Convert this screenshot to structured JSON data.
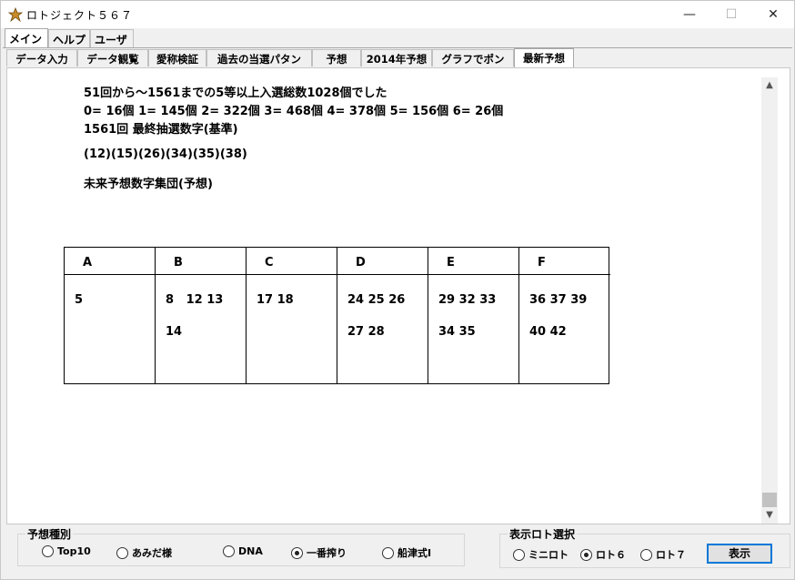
{
  "window": {
    "title": "ロトジェクト５６７",
    "controls": {
      "minimize": "—",
      "maximize": "☐",
      "close": "✕"
    }
  },
  "main_tabs": [
    "メイン",
    "ヘルプ",
    "ユーザ"
  ],
  "sub_tabs": [
    "データ入力",
    "データ観覧",
    "愛称検証",
    "過去の当選パタン",
    "予想",
    "2014年予想",
    "グラフでポン",
    "最新予想"
  ],
  "summary": {
    "line1": "51回から～1561までの5等以上入選総数1028個でした",
    "line2": "0= 16個  1= 145個  2= 322個  3= 468個  4= 378個  5= 156個  6= 26個",
    "line3": "1561回 最終抽選数字(基準)",
    "base_numbers": "(12)(15)(26)(34)(35)(38)",
    "group_title": "未来予想数字集団(予想)"
  },
  "groups": [
    {
      "label": "A",
      "row1": "5",
      "row2": ""
    },
    {
      "label": "B",
      "row1": "8   12 13",
      "row2": "14"
    },
    {
      "label": "C",
      "row1": "17 18",
      "row2": ""
    },
    {
      "label": "D",
      "row1": "24 25 26",
      "row2": "27 28"
    },
    {
      "label": "E",
      "row1": "29 32 33",
      "row2": "34 35"
    },
    {
      "label": "F",
      "row1": "36 37 39",
      "row2": "40 42"
    }
  ],
  "prediction_type": {
    "title": "予想種別",
    "options": [
      "Top10",
      "あみだ様",
      "DNA",
      "一番搾り",
      "船津式Ⅰ"
    ],
    "selected": "一番搾り"
  },
  "lotto_select": {
    "title": "表示ロト選択",
    "options": [
      "ミニロト",
      "ロト６",
      "ロト７"
    ],
    "selected": "ロト６"
  },
  "show_button": "表示"
}
